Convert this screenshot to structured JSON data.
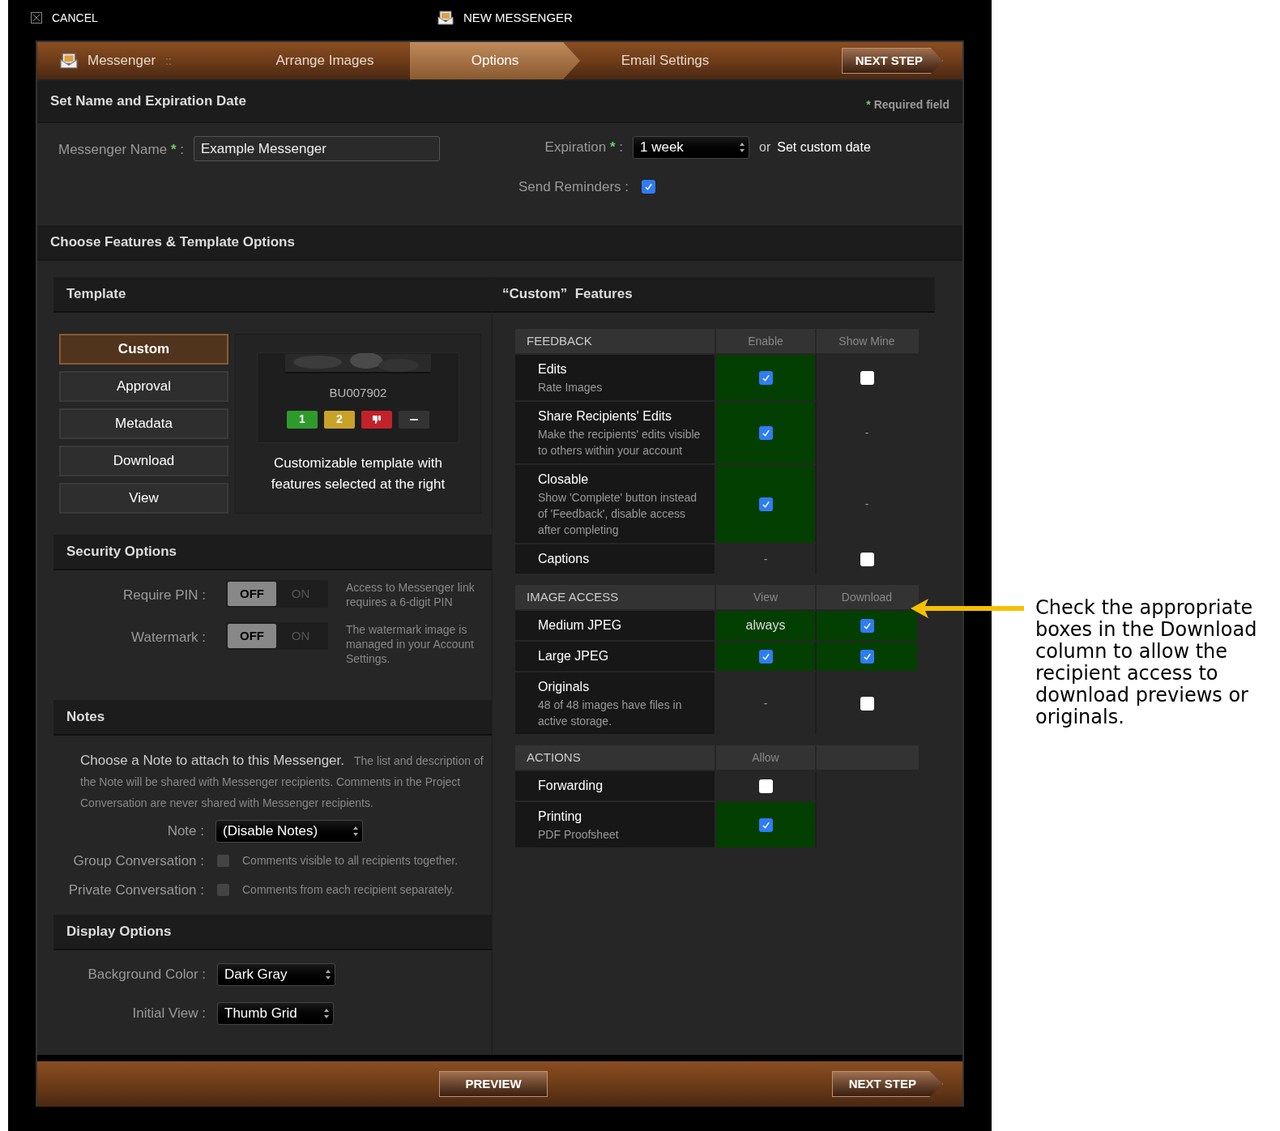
{
  "header": {
    "cancel": "CANCEL",
    "title": "NEW MESSENGER"
  },
  "steps": [
    {
      "label": "Messenger",
      "selected": false,
      "kind": "home"
    },
    {
      "label": "Arrange Images",
      "selected": false,
      "kind": "step"
    },
    {
      "label": "Options",
      "selected": true,
      "kind": "step"
    },
    {
      "label": "Email Settings",
      "selected": false,
      "kind": "step"
    }
  ],
  "step_separator": "::",
  "next_step": "NEXT STEP",
  "name_section": {
    "title": "Set Name and Expiration Date",
    "required_mark": "*",
    "required_note": "Required field",
    "name_field": {
      "label": "Messenger Name",
      "required_mark": "*",
      "suffix": ":",
      "value": "Example Messenger"
    },
    "expiration_field": {
      "label": "Expiration",
      "required_mark": "*",
      "suffix": ":",
      "value": "1 week"
    },
    "or": "or",
    "custom_date": "Set custom date",
    "reminders": {
      "label": "Send Reminders :",
      "checked": true
    }
  },
  "features_title": "Choose Features & Template Options",
  "template": {
    "title": "Template",
    "options": [
      {
        "label": "Custom",
        "selected": true
      },
      {
        "label": "Approval",
        "selected": false
      },
      {
        "label": "Metadata",
        "selected": false
      },
      {
        "label": "Download",
        "selected": false
      },
      {
        "label": "View",
        "selected": false
      }
    ],
    "preview": {
      "image_id": "BU007902",
      "ratings": [
        {
          "kind": "number",
          "label": "1",
          "color": "#2f9a2c"
        },
        {
          "kind": "number",
          "label": "2",
          "color": "#c9a22a"
        },
        {
          "kind": "reject",
          "color": "#c4222a"
        },
        {
          "kind": "clear",
          "color": "#333333"
        }
      ]
    },
    "description": "Customizable template with features selected at the right"
  },
  "security": {
    "title": "Security Options",
    "options": [
      {
        "label": "Require PIN :",
        "on": false,
        "off_label": "OFF",
        "on_label": "ON",
        "help": "Access to Messenger link requires a 6-digit PIN"
      },
      {
        "label": "Watermark :",
        "on": false,
        "off_label": "OFF",
        "on_label": "ON",
        "help": "The watermark image is managed in your Account Settings."
      }
    ]
  },
  "notes": {
    "title": "Notes",
    "lead": "Choose a Note to attach to this Messenger.",
    "text": "The list and description of the Note will be shared with Messenger recipients. Comments in the Project Conversation are never shared with Messenger recipients.",
    "note_label": "Note :",
    "note_value": "(Disable Notes)",
    "conversations": [
      {
        "label": "Group Conversation :",
        "checked": false,
        "help": "Comments visible to all recipients together."
      },
      {
        "label": "Private Conversation :",
        "checked": false,
        "help": "Comments from each recipient separately."
      }
    ]
  },
  "display": {
    "title": "Display Options",
    "options": [
      {
        "label": "Background Color :",
        "value": "Dark Gray"
      },
      {
        "label": "Initial View :",
        "value": "Thumb Grid"
      }
    ]
  },
  "custom_features": {
    "title": "“Custom”  Features",
    "groups": [
      {
        "title": "FEEDBACK",
        "columns": [
          "Enable",
          "Show Mine"
        ],
        "rows": [
          {
            "name": "Edits",
            "description": "Rate Images",
            "cells": [
              {
                "kind": "checkbox",
                "checked": true
              },
              {
                "kind": "checkbox",
                "checked": false
              }
            ]
          },
          {
            "name": "Share Recipients' Edits",
            "description": "Make the recipients' edits visible to others within your account",
            "cells": [
              {
                "kind": "checkbox",
                "checked": true
              },
              {
                "kind": "text",
                "text": "-"
              }
            ]
          },
          {
            "name": "Closable",
            "description": "Show 'Complete' button instead of 'Feedback', disable access after completing",
            "cells": [
              {
                "kind": "checkbox",
                "checked": true
              },
              {
                "kind": "text",
                "text": "-"
              }
            ]
          },
          {
            "name": "Captions",
            "cells": [
              {
                "kind": "text",
                "text": "-"
              },
              {
                "kind": "checkbox",
                "checked": false
              }
            ]
          }
        ]
      },
      {
        "title": "IMAGE ACCESS",
        "columns": [
          "View",
          "Download"
        ],
        "rows": [
          {
            "name": "Medium JPEG",
            "cells": [
              {
                "kind": "always",
                "text": "always"
              },
              {
                "kind": "checkbox",
                "checked": true
              }
            ]
          },
          {
            "name": "Large JPEG",
            "cells": [
              {
                "kind": "checkbox",
                "checked": true
              },
              {
                "kind": "checkbox",
                "checked": true
              }
            ]
          },
          {
            "name": "Originals",
            "description": "48 of 48 images have files in active storage.",
            "cells": [
              {
                "kind": "text",
                "text": "-"
              },
              {
                "kind": "checkbox",
                "checked": false
              }
            ]
          }
        ]
      },
      {
        "title": "ACTIONS",
        "columns": [
          "Allow"
        ],
        "rows": [
          {
            "name": "Forwarding",
            "cells": [
              {
                "kind": "checkbox",
                "checked": false
              },
              {
                "kind": "empty"
              }
            ]
          },
          {
            "name": "Printing",
            "description": "PDF Proofsheet",
            "cells": [
              {
                "kind": "checkbox",
                "checked": true
              },
              {
                "kind": "empty"
              }
            ]
          }
        ]
      }
    ]
  },
  "footer": {
    "preview": "PREVIEW",
    "next_step": "NEXT STEP"
  },
  "annotation": "Check the appropriate boxes in the Download column to allow the recipient access to download previews or originals."
}
